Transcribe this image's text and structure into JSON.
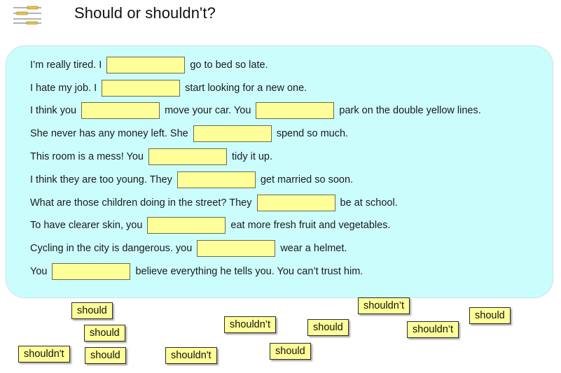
{
  "header": {
    "title": "Should or shouldn't?",
    "logo_icon": "fill-in-the-blanks-icon"
  },
  "colors": {
    "panel_background": "#ccfdfd",
    "blank_fill": "#ffff99",
    "tile_fill": "#ffff99"
  },
  "sentences": [
    {
      "parts": [
        "I’m really tired. I",
        "go to bed so late."
      ],
      "blanks": [
        ""
      ]
    },
    {
      "parts": [
        "I hate my job. I",
        "start looking for a new one."
      ],
      "blanks": [
        ""
      ]
    },
    {
      "parts": [
        "I think you",
        "move your car. You",
        "park on the double yellow lines."
      ],
      "blanks": [
        "",
        ""
      ]
    },
    {
      "parts": [
        "She never has any money left. She",
        "spend so much."
      ],
      "blanks": [
        ""
      ]
    },
    {
      "parts": [
        "This room is a mess! You",
        "tidy it up."
      ],
      "blanks": [
        ""
      ]
    },
    {
      "parts": [
        "I think they are too young. They",
        "get married so soon."
      ],
      "blanks": [
        ""
      ]
    },
    {
      "parts": [
        "What are those children doing in the street? They",
        "be at school."
      ],
      "blanks": [
        ""
      ]
    },
    {
      "parts": [
        "To have clearer skin, you",
        "eat more fresh fruit and vegetables."
      ],
      "blanks": [
        ""
      ]
    },
    {
      "parts": [
        "Cycling in the city is dangerous. you",
        "wear a helmet."
      ],
      "blanks": [
        ""
      ]
    },
    {
      "parts": [
        "You",
        "believe everything he tells you. You can’t trust him."
      ],
      "blanks": [
        ""
      ]
    }
  ],
  "tiles": [
    {
      "label": "should"
    },
    {
      "label": "should"
    },
    {
      "label": "shouldn't"
    },
    {
      "label": "should"
    },
    {
      "label": "shouldn't"
    },
    {
      "label": "shouldn’t"
    },
    {
      "label": "should"
    },
    {
      "label": "should"
    },
    {
      "label": "shouldn’t"
    },
    {
      "label": "shouldn’t"
    },
    {
      "label": "should"
    }
  ]
}
